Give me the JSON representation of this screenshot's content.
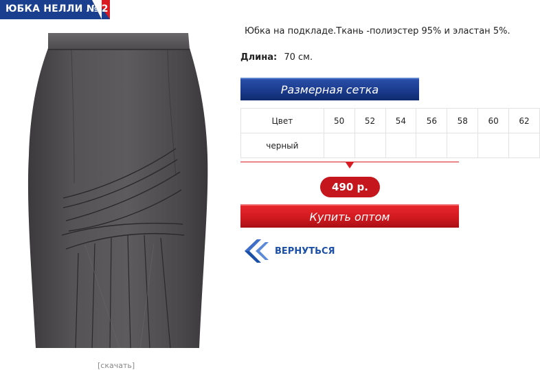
{
  "header": {
    "title": "ЮБКА НЕЛЛИ № 2"
  },
  "product": {
    "image_icon": "skirt-photo",
    "enlarge_label": "[скачать]",
    "description": "Юбка на подкладе.Ткань -полиэстер 95% и эластан 5%.",
    "length_label": "Длина:",
    "length_value": "70 см."
  },
  "size_chart": {
    "button_label": "Размерная сетка",
    "header_color": "Цвет",
    "sizes": [
      "50",
      "52",
      "54",
      "56",
      "58",
      "60",
      "62"
    ],
    "rows": [
      {
        "color": "черный"
      }
    ]
  },
  "pricing": {
    "price": "490 р.",
    "buy_label": "Купить оптом"
  },
  "navigation": {
    "back_label": "ВЕРНУТЬСЯ",
    "back_icon": "double-chevron-left-icon"
  },
  "colors": {
    "brand_blue": "#1a3f8f",
    "brand_red": "#d91c24"
  }
}
